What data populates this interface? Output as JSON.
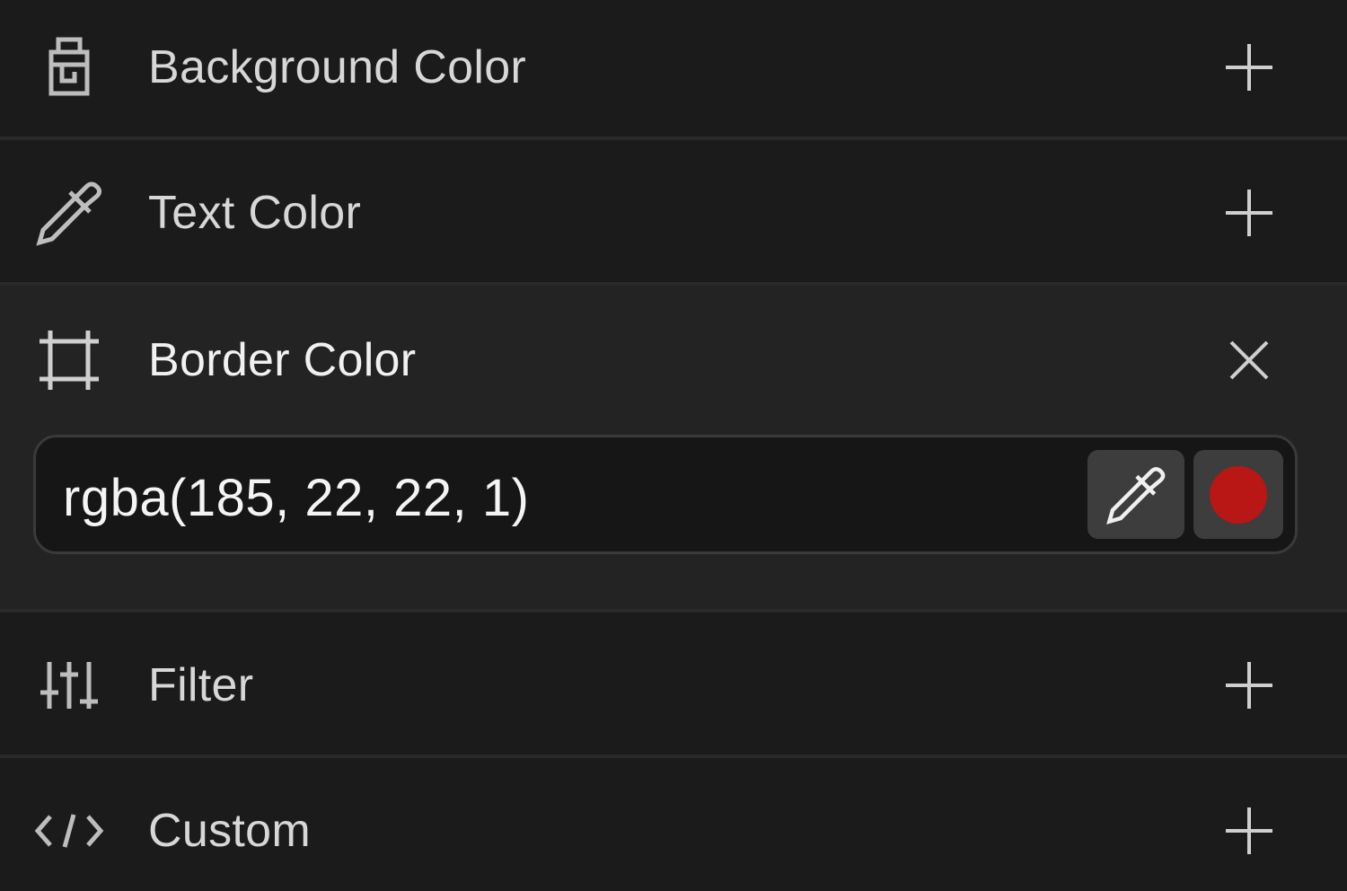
{
  "sections": {
    "background_color": {
      "label": "Background Color",
      "icon": "paint-bucket-icon",
      "action": "add"
    },
    "text_color": {
      "label": "Text Color",
      "icon": "eyedropper-icon",
      "action": "add"
    },
    "border_color": {
      "label": "Border Color",
      "icon": "border-frame-icon",
      "action": "remove",
      "value": "rgba(185, 22, 22, 1)",
      "swatch_color": "#b91616"
    },
    "filter": {
      "label": "Filter",
      "icon": "sliders-icon",
      "action": "add"
    },
    "custom": {
      "label": "Custom",
      "icon": "code-icon",
      "action": "add"
    }
  }
}
